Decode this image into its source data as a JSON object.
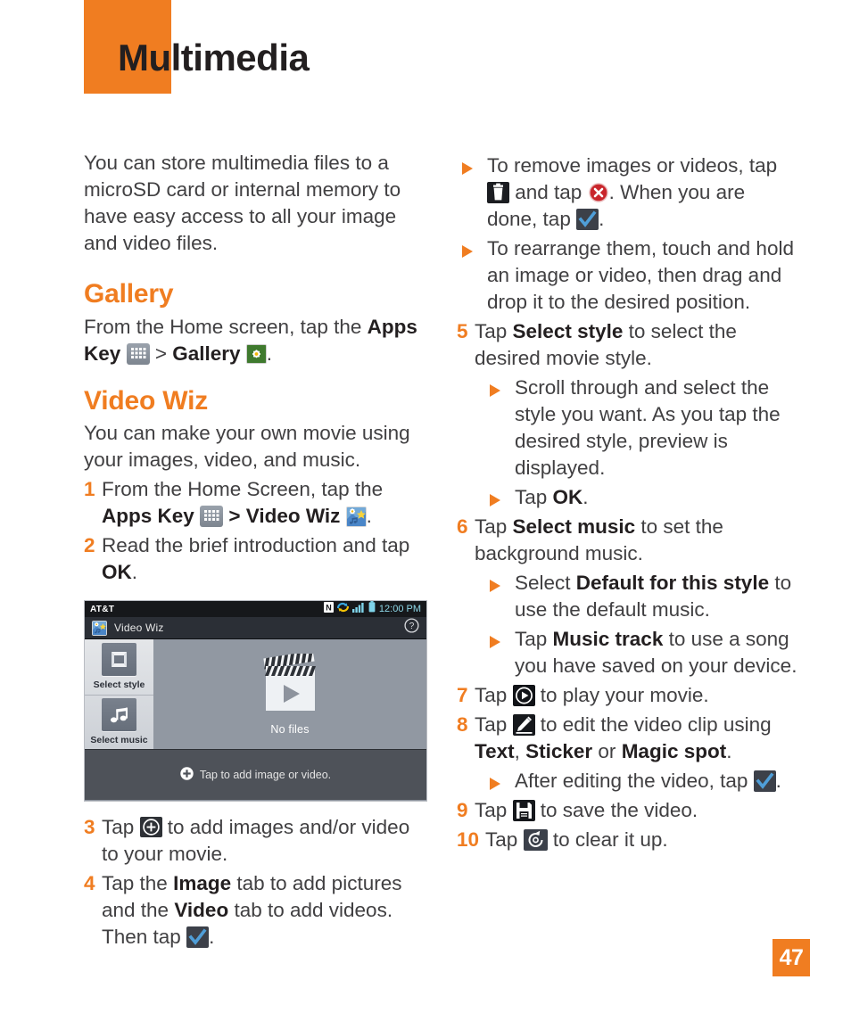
{
  "colors": {
    "accent_orange": "#f07d21",
    "body_text": "#414042",
    "heading_black": "#231f20"
  },
  "header": {
    "title": "Multimedia"
  },
  "page_number": "47",
  "left_column": {
    "intro": "You can store multimedia files to a microSD card or internal memory to have easy access to all your image and video files.",
    "gallery": {
      "heading": "Gallery",
      "line_part1": "From the Home screen, tap the ",
      "apps_key": "Apps Key",
      "gt": ">",
      "gallery_label": "Gallery",
      "period": "."
    },
    "video_wiz": {
      "heading": "Video Wiz",
      "intro": "You can make your own movie using your images, video, and music.",
      "steps": [
        {
          "num": "1",
          "part1": "From the Home Screen, tap the ",
          "bold1": "Apps Key",
          "gt": ">",
          "bold2": "Video Wiz",
          "tail": "."
        },
        {
          "num": "2",
          "part1": "Read the brief introduction and tap ",
          "bold1": "OK",
          "tail": "."
        },
        {
          "num": "3",
          "part1": "Tap ",
          "part2": " to add images and/or video to your movie."
        },
        {
          "num": "4",
          "part1": "Tap the ",
          "bold1": "Image",
          "part2": " tab to add pictures and the ",
          "bold2": "Video",
          "part3": " tab to add videos. Then tap ",
          "tail": "."
        }
      ]
    },
    "phone_screenshot": {
      "carrier": "AT&T",
      "clock": "12:00 PM",
      "status_icons": [
        "nfc-icon",
        "sync-icon",
        "signal-bars-icon",
        "battery-icon"
      ],
      "app_title": "Video Wiz",
      "help_icon": "help-circle-icon",
      "side_buttons": [
        {
          "label": "Select style",
          "icon": "frame-icon"
        },
        {
          "label": "Select music",
          "icon": "music-note-icon"
        }
      ],
      "main_placeholder": "No files",
      "main_icon": "clapperboard-play-icon",
      "add_bar_label": "Tap to add image or video.",
      "add_bar_icon": "plus-circle-icon"
    }
  },
  "right_column": {
    "bullets_top": [
      {
        "part1": "To remove images or videos, tap ",
        "part2": " and tap ",
        "part3": ". When you are done, tap ",
        "tail": "."
      },
      {
        "text": "To rearrange them, touch and hold an image or video, then drag and drop it to the desired position."
      }
    ],
    "steps": [
      {
        "num": "5",
        "part1": "Tap ",
        "bold1": "Select style",
        "part2": " to select the desired movie style.",
        "bullets": [
          {
            "text": "Scroll through and select the style you want. As you tap the desired style, preview is displayed."
          },
          {
            "part1": "Tap ",
            "bold1": "OK",
            "tail": "."
          }
        ]
      },
      {
        "num": "6",
        "part1": "Tap ",
        "bold1": "Select music",
        "part2": " to set the background music.",
        "bullets": [
          {
            "part1": "Select ",
            "bold1": "Default for this style",
            "part2": " to use the default music."
          },
          {
            "part1": "Tap ",
            "bold1": "Music track",
            "part2": " to use a song you have saved on your device."
          }
        ]
      },
      {
        "num": "7",
        "part1": "Tap ",
        "part2": " to play your movie."
      },
      {
        "num": "8",
        "part1": "Tap ",
        "part2": " to edit the video clip using ",
        "bold1": "Text",
        "comma": ", ",
        "bold2": "Sticker",
        "or": " or ",
        "bold3": "Magic spot",
        "tail": ".",
        "bullets": [
          {
            "part1": "After editing the video, tap ",
            "tail": "."
          }
        ]
      },
      {
        "num": "9",
        "part1": "Tap ",
        "part2": " to save the video."
      },
      {
        "num": "10",
        "part1": "Tap ",
        "part2": " to clear it up."
      }
    ]
  }
}
